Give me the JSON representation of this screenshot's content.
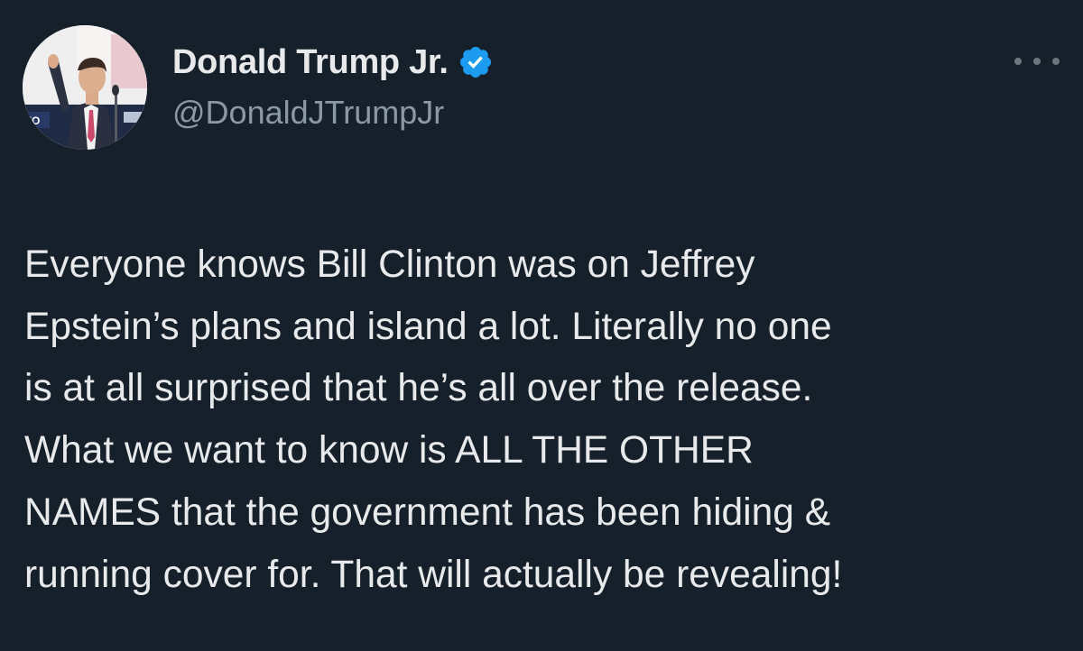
{
  "author": {
    "display_name": "Donald Trump Jr.",
    "handle": "@DonaldJTrumpJr",
    "verified": true,
    "verified_badge_color": "#1d9bf0"
  },
  "avatar": {
    "banner_text": "YO"
  },
  "menu": {
    "icon": "more-horizontal-icon"
  },
  "tweet": {
    "lines": [
      "Everyone knows Bill Clinton was on Jeffrey",
      "Epstein’s plans and island a lot. Literally no one",
      "is at all surprised that he’s all over the release.",
      "What we want to know is ALL THE OTHER",
      "NAMES that the government has been hiding &",
      "running cover for. That will actually be revealing!"
    ]
  },
  "colors": {
    "background": "#15202b",
    "text_primary": "#e7e9ea",
    "text_secondary": "#8b98a5"
  }
}
